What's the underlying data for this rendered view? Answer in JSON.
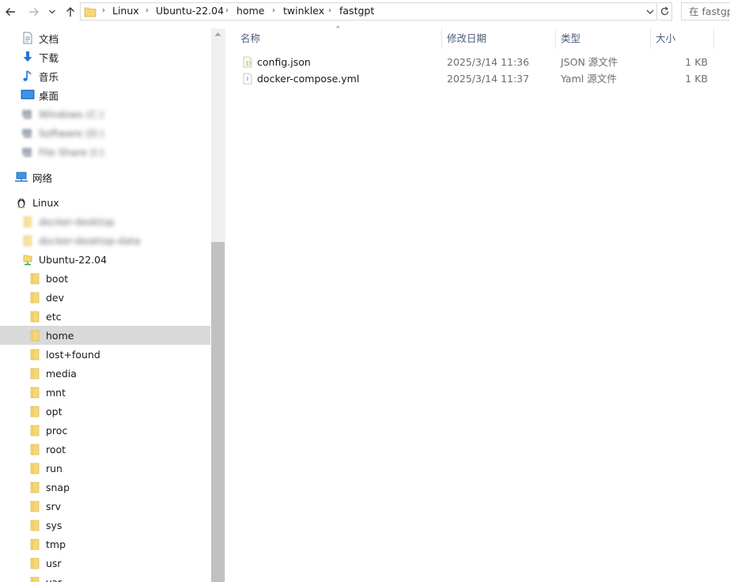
{
  "address": {
    "crumbs": [
      "Linux",
      "Ubuntu-22.04",
      "home",
      "twinklex",
      "fastgpt"
    ],
    "search_placeholder": "在 fastgpt"
  },
  "nav": {
    "items": [
      {
        "label": "文档",
        "icon": "document-icon"
      },
      {
        "label": "下载",
        "icon": "download-icon"
      },
      {
        "label": "音乐",
        "icon": "music-icon"
      },
      {
        "label": "桌面",
        "icon": "desktop-icon"
      },
      {
        "label": "Windows (C:)",
        "icon": "drive-icon",
        "blurred": true
      },
      {
        "label": "Software (D:)",
        "icon": "drive-icon",
        "blurred": true
      },
      {
        "label": "File Share (I:)",
        "icon": "drive-icon",
        "blurred": true
      },
      {
        "label": "网络",
        "icon": "network-icon"
      },
      {
        "label": "Linux",
        "icon": "linux-icon"
      },
      {
        "label": "docker-desktop",
        "icon": "folder-icon",
        "blurred": true
      },
      {
        "label": "docker-desktop-data",
        "icon": "folder-icon",
        "blurred": true
      },
      {
        "label": "Ubuntu-22.04",
        "icon": "linux-drive-icon"
      },
      {
        "label": "boot",
        "icon": "folder-icon"
      },
      {
        "label": "dev",
        "icon": "folder-icon"
      },
      {
        "label": "etc",
        "icon": "folder-icon"
      },
      {
        "label": "home",
        "icon": "folder-icon",
        "selected": true
      },
      {
        "label": "lost+found",
        "icon": "folder-icon"
      },
      {
        "label": "media",
        "icon": "folder-icon"
      },
      {
        "label": "mnt",
        "icon": "folder-icon"
      },
      {
        "label": "opt",
        "icon": "folder-icon"
      },
      {
        "label": "proc",
        "icon": "folder-icon"
      },
      {
        "label": "root",
        "icon": "folder-icon"
      },
      {
        "label": "run",
        "icon": "folder-icon"
      },
      {
        "label": "snap",
        "icon": "folder-icon"
      },
      {
        "label": "srv",
        "icon": "folder-icon"
      },
      {
        "label": "sys",
        "icon": "folder-icon"
      },
      {
        "label": "tmp",
        "icon": "folder-icon"
      },
      {
        "label": "usr",
        "icon": "folder-icon"
      },
      {
        "label": "var",
        "icon": "folder-icon"
      }
    ]
  },
  "filelist": {
    "columns": {
      "name": "名称",
      "modified": "修改日期",
      "type": "类型",
      "size": "大小"
    },
    "files": [
      {
        "name": "config.json",
        "modified": "2025/3/14 11:36",
        "type": "JSON 源文件",
        "size": "1 KB",
        "icon": "json-file-icon"
      },
      {
        "name": "docker-compose.yml",
        "modified": "2025/3/14 11:37",
        "type": "Yaml 源文件",
        "size": "1 KB",
        "icon": "yaml-file-icon"
      }
    ]
  },
  "colors": {
    "selection": "#d9d9d9",
    "header_text": "#4c607a",
    "folder": "#f6d776",
    "accent_blue": "#1e78d7"
  }
}
